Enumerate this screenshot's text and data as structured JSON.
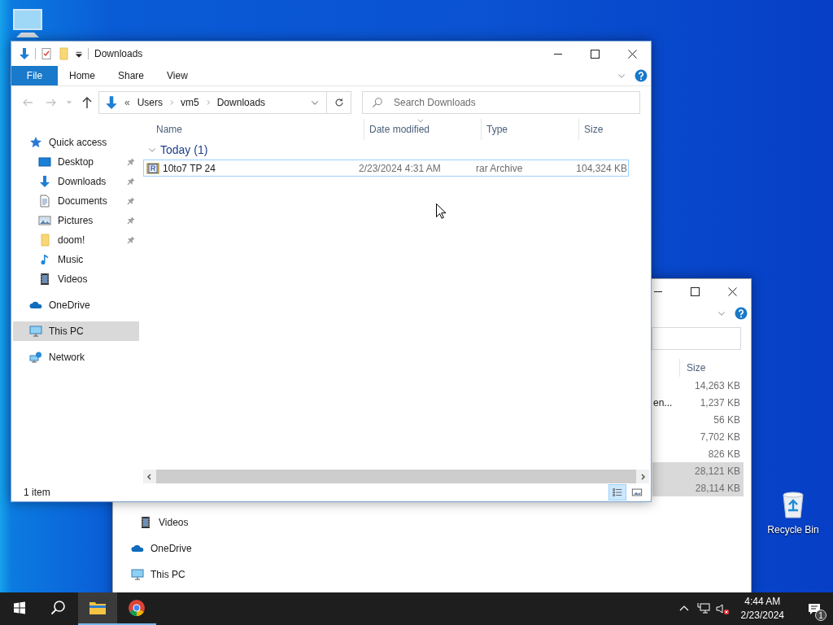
{
  "desktop_icons": [
    {
      "kind": "computer"
    },
    {
      "kind": "recycle_bin",
      "label": "Recycle Bin"
    }
  ],
  "back_window": {
    "columns": [
      {
        "label": "Size"
      }
    ],
    "rows": [
      {
        "size": "14,263 KB",
        "selected": false
      },
      {
        "column_3": "en...",
        "size": "1,237 KB",
        "selected": false
      },
      {
        "size": "56 KB",
        "selected": false
      },
      {
        "size": "7,702 KB",
        "selected": false
      },
      {
        "size": "826 KB",
        "selected": false
      },
      {
        "size": "28,121 KB",
        "selected": true
      },
      {
        "size": "28,114 KB",
        "selected": true
      }
    ],
    "nav": [
      {
        "label": "Videos",
        "kind": "videos",
        "child": true
      },
      {
        "label": "OneDrive",
        "kind": "onedrive",
        "child": false
      },
      {
        "label": "This PC",
        "kind": "pc",
        "child": false
      }
    ]
  },
  "window": {
    "title": "Downloads",
    "ribbon_tabs": [
      {
        "label": "File",
        "kind": "file"
      },
      {
        "label": "Home",
        "kind": "tab"
      },
      {
        "label": "Share",
        "kind": "tab"
      },
      {
        "label": "View",
        "kind": "tab"
      }
    ],
    "address": {
      "overflow": "«",
      "crumbs": [
        "Users",
        "vm5",
        "Downloads"
      ]
    },
    "search": {
      "placeholder": "Search Downloads"
    },
    "nav": [
      {
        "label": "Quick access",
        "kind": "star",
        "selected": false,
        "children": [
          {
            "label": "Desktop",
            "kind": "desktop",
            "pinned": true,
            "selected": false
          },
          {
            "label": "Downloads",
            "kind": "downloads",
            "pinned": true,
            "selected": false
          },
          {
            "label": "Documents",
            "kind": "documents",
            "pinned": true,
            "selected": false
          },
          {
            "label": "Pictures",
            "kind": "pictures",
            "pinned": true,
            "selected": false
          },
          {
            "label": "doom!",
            "kind": "folder",
            "pinned": true,
            "selected": false
          },
          {
            "label": "Music",
            "kind": "music",
            "pinned": false,
            "selected": false
          },
          {
            "label": "Videos",
            "kind": "videos",
            "pinned": false,
            "selected": false
          }
        ]
      },
      {
        "label": "OneDrive",
        "kind": "onedrive",
        "selected": false
      },
      {
        "label": "This PC",
        "kind": "pc",
        "selected": true
      },
      {
        "label": "Network",
        "kind": "network",
        "selected": false
      }
    ],
    "columns": [
      {
        "label": "Name",
        "sorted": false
      },
      {
        "label": "Date modified",
        "sorted": true
      },
      {
        "label": "Type",
        "sorted": false
      },
      {
        "label": "Size",
        "sorted": false
      }
    ],
    "groups": [
      {
        "label": "Today (1)",
        "expanded": true,
        "rows": [
          {
            "name": "10to7 TP 24",
            "date": "2/23/2024 4:31 AM",
            "type": "rar Archive",
            "size": "104,324 KB",
            "selected": true
          }
        ]
      }
    ],
    "status_bar": {
      "count": "1 item",
      "views": [
        {
          "kind": "details",
          "selected": true
        },
        {
          "kind": "large_icons",
          "selected": false
        }
      ]
    }
  },
  "taskbar": {
    "apps": [
      {
        "kind": "explorer",
        "active": true,
        "running": true
      },
      {
        "kind": "browser",
        "active": false,
        "running": true
      }
    ],
    "tray": {
      "volume_muted": true,
      "time": "4:44 AM",
      "date": "2/23/2024",
      "notification_count": "1"
    }
  }
}
